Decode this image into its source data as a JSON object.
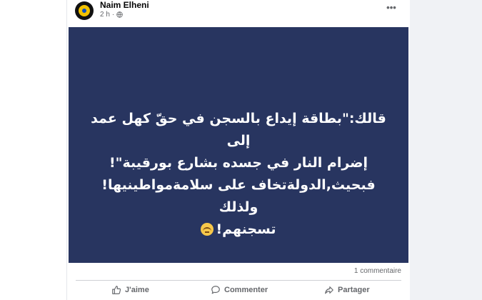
{
  "post": {
    "author": "Naim Elheni",
    "time": "2 h",
    "more_label": "•••",
    "text_lines": [
      "قالك:\"بطاقة إيداع بالسجن في حقّ كهل عمد إلى",
      "إضرام النار في جسده بشارع بورقيبة\"!",
      "فبحيث,الدولةتخاف على سلامةمواطينيها!ولذلك",
      "تسجنهم!"
    ],
    "emoji_icon": "flushed-face-icon",
    "image_background": "#283560",
    "comments_count": "1 commentaire"
  },
  "actions": {
    "like_label": "J'aime",
    "comment_label": "Commenter",
    "share_label": "Partager"
  },
  "colors": {
    "text_primary": "#050505",
    "text_secondary": "#65676b",
    "page_background": "#f0f2f5"
  }
}
